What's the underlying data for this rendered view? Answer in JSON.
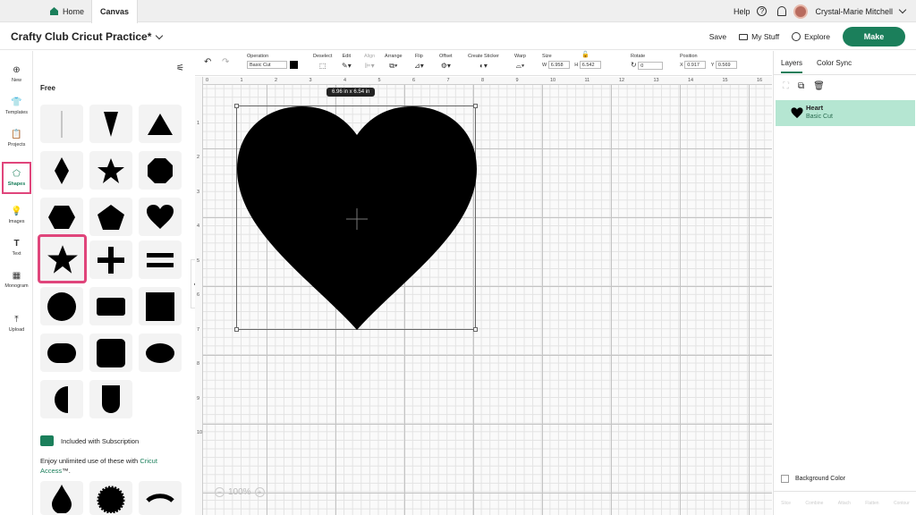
{
  "topbar": {
    "tabs": [
      {
        "label": "Home"
      },
      {
        "label": "Canvas"
      }
    ],
    "help_label": "Help",
    "user_name": "Crystal-Marie Mitchell"
  },
  "header": {
    "project_title": "Crafty Club Cricut Practice*",
    "save_label": "Save",
    "mystuff_label": "My Stuff",
    "explore_label": "Explore",
    "make_label": "Make"
  },
  "leftnav": {
    "items": [
      {
        "label": "New",
        "icon": "plus-icon"
      },
      {
        "label": "Templates",
        "icon": "shirt-icon"
      },
      {
        "label": "Projects",
        "icon": "clipboard-icon"
      },
      {
        "label": "Shapes",
        "icon": "shapes-icon",
        "active": true
      },
      {
        "label": "Images",
        "icon": "bulb-icon"
      },
      {
        "label": "Text",
        "icon": "text-icon"
      },
      {
        "label": "Monogram",
        "icon": "monogram-icon"
      },
      {
        "label": "Upload",
        "icon": "upload-icon"
      }
    ]
  },
  "shapes_panel": {
    "free_label": "Free",
    "shapes": [
      "line",
      "triangle-down",
      "triangle",
      "diamond",
      "star",
      "octagon",
      "hexagon",
      "pentagon",
      "heart",
      "star-selected",
      "plus",
      "equals",
      "circle",
      "rounded-rect",
      "square",
      "pill",
      "rounded-square",
      "ellipse",
      "half-circle",
      "arch"
    ],
    "subscription_label": "Included with Subscription",
    "sub_text_1": "Enjoy unlimited use of these with ",
    "sub_link": "Cricut Access",
    "sub_text_2": "™.",
    "premium_shapes": [
      "drop",
      "scallop-circle",
      "arc"
    ]
  },
  "toolbar": {
    "operation_label": "Operation",
    "operation_value": "Basic Cut",
    "deselect_label": "Deselect",
    "edit_label": "Edit",
    "align_label": "Align",
    "arrange_label": "Arrange",
    "flip_label": "Flip",
    "offset_label": "Offset",
    "sticker_label": "Create Sticker",
    "warp_label": "Warp",
    "size_label": "Size",
    "w_label": "W",
    "w_value": "6.958",
    "h_label": "H",
    "h_value": "6.542",
    "rotate_label": "Rotate",
    "rotate_value": "0",
    "position_label": "Position",
    "x_label": "X",
    "x_value": "0.917",
    "y_label": "Y",
    "y_value": "0.569"
  },
  "canvas": {
    "ruler_top": [
      "0",
      "1",
      "2",
      "3",
      "4",
      "5",
      "6",
      "7",
      "8",
      "9",
      "10",
      "11",
      "12",
      "13",
      "14",
      "15",
      "16"
    ],
    "ruler_left": [
      "0",
      "1",
      "2",
      "3",
      "4",
      "5",
      "6",
      "7",
      "8",
      "9",
      "10"
    ],
    "size_tooltip": "6.96  in x 6.54  in",
    "zoom_label": "100%"
  },
  "right_panel": {
    "tabs": [
      {
        "label": "Layers"
      },
      {
        "label": "Color Sync"
      }
    ],
    "layer_name": "Heart",
    "layer_op": "Basic Cut",
    "bg_label": "Background Color",
    "bottom_actions": [
      "Slice",
      "Combine",
      "Attach",
      "Flatten",
      "Contour"
    ]
  },
  "colors": {
    "accent": "#1b7f5b",
    "highlight": "#e0457b",
    "layer_bg": "#b5e6d2"
  }
}
